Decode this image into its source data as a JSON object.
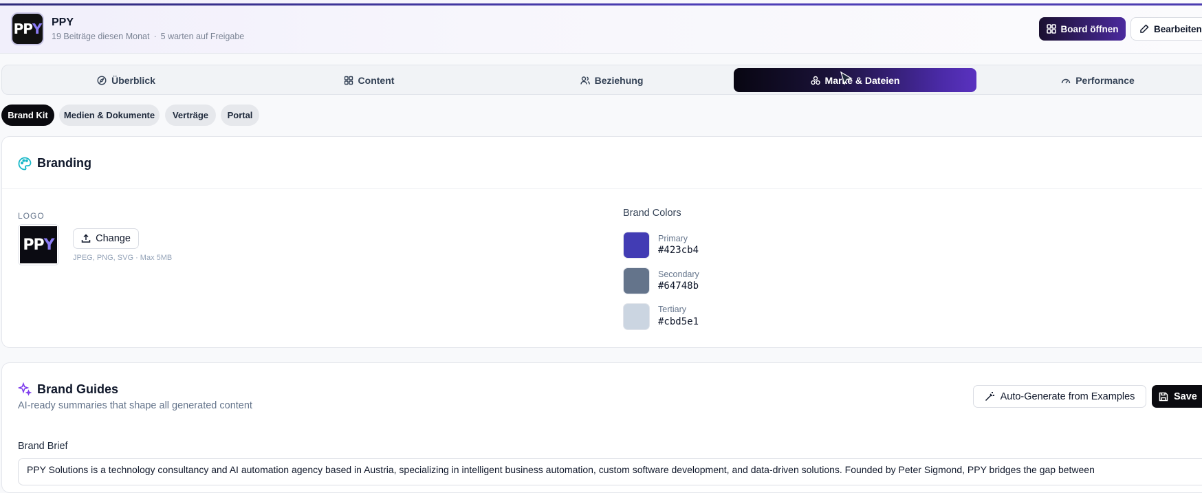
{
  "header": {
    "logo_text": "PPY",
    "name": "PPY",
    "posts_this_month": "19 Beiträge diesen Monat",
    "separator": "·",
    "pending_approval": "5 warten auf Freigabe",
    "board_button": "Board öffnen",
    "edit_button": "Bearbeiten"
  },
  "tabs": [
    {
      "label": "Überblick",
      "icon": "compass-icon"
    },
    {
      "label": "Content",
      "icon": "grid-icon"
    },
    {
      "label": "Beziehung",
      "icon": "users-icon"
    },
    {
      "label": "Marke & Dateien",
      "icon": "shapes-icon",
      "active": true
    },
    {
      "label": "Performance",
      "icon": "gauge-icon"
    }
  ],
  "subtabs": [
    {
      "label": "Brand Kit",
      "active": true
    },
    {
      "label": "Medien & Dokumente"
    },
    {
      "label": "Verträge"
    },
    {
      "label": "Portal"
    }
  ],
  "branding": {
    "title": "Branding",
    "logo_label": "LOGO",
    "change_button": "Change",
    "file_hint": "JPEG, PNG, SVG · Max 5MB",
    "colors_title": "Brand Colors",
    "colors": [
      {
        "name": "Primary",
        "hex": "#423cb4"
      },
      {
        "name": "Secondary",
        "hex": "#64748b"
      },
      {
        "name": "Tertiary",
        "hex": "#cbd5e1"
      }
    ]
  },
  "guides": {
    "title": "Brand Guides",
    "subtitle": "AI-ready summaries that shape all generated content",
    "auto_generate_button": "Auto-Generate from Examples",
    "save_button": "Save",
    "brief_label": "Brand Brief",
    "brief_text": "PPY Solutions is a technology consultancy and AI automation agency based in Austria, specializing in intelligent business automation, custom software development, and data-driven solutions. Founded by Peter Sigmond, PPY bridges the gap between"
  }
}
